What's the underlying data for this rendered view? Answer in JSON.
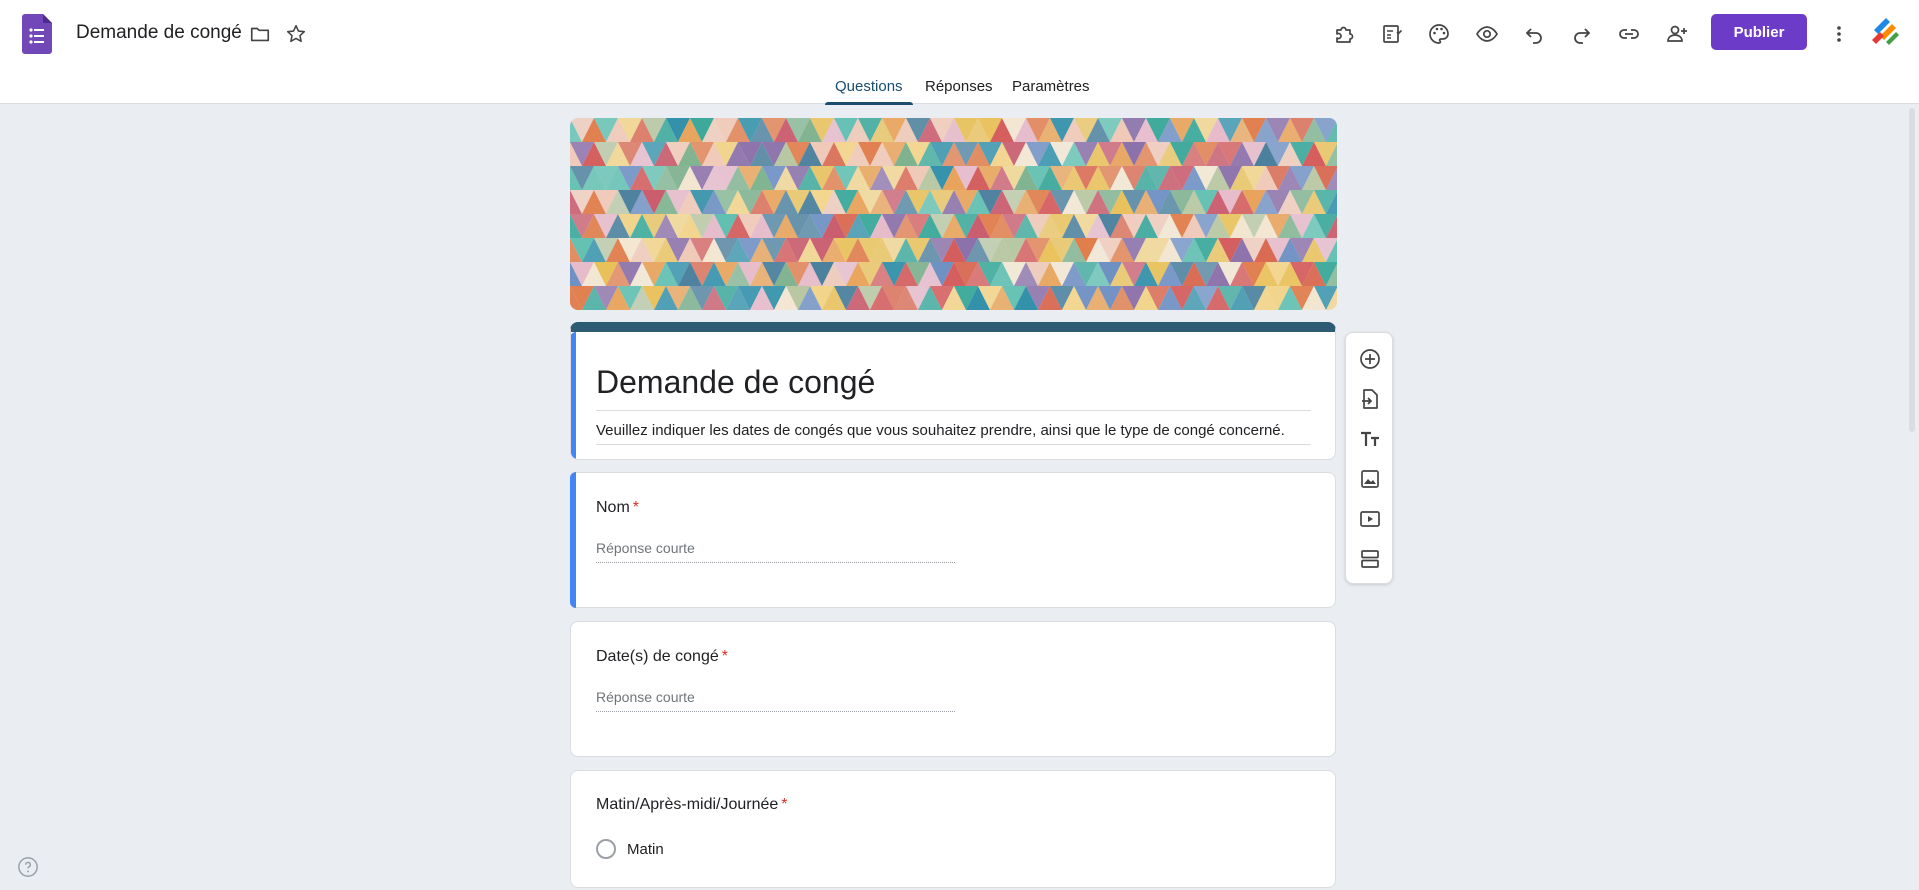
{
  "app": {
    "doc_title": "Demande de congé",
    "publish_label": "Publier",
    "colors": {
      "accent": "#6c3bc8",
      "theme": "#2d5b73",
      "focus": "#4285f4",
      "required": "#d93025"
    }
  },
  "tabs": [
    {
      "label": "Questions",
      "active": true
    },
    {
      "label": "Réponses",
      "active": false
    },
    {
      "label": "Paramètres",
      "active": false
    }
  ],
  "toolbar_icons": [
    "addons-icon",
    "quiz-icon",
    "palette-icon",
    "preview-icon",
    "undo-icon",
    "redo-icon",
    "link-icon",
    "add-collaborator-icon",
    "more-icon"
  ],
  "form": {
    "title": "Demande de congé",
    "description": "Veuillez indiquer les dates de congés que vous souhaitez prendre, ainsi que le type de congé concerné."
  },
  "questions": [
    {
      "title": "Nom",
      "required_mark": "*",
      "placeholder": "Réponse courte"
    },
    {
      "title": "Date(s) de congé",
      "required_mark": "*",
      "placeholder": "Réponse courte"
    },
    {
      "title": "Matin/Après-midi/Journée",
      "required_mark": "*",
      "options": [
        "Matin"
      ]
    }
  ],
  "side_toolbar": [
    "add-question-icon",
    "import-questions-icon",
    "add-title-icon",
    "add-image-icon",
    "add-video-icon",
    "add-section-icon"
  ]
}
